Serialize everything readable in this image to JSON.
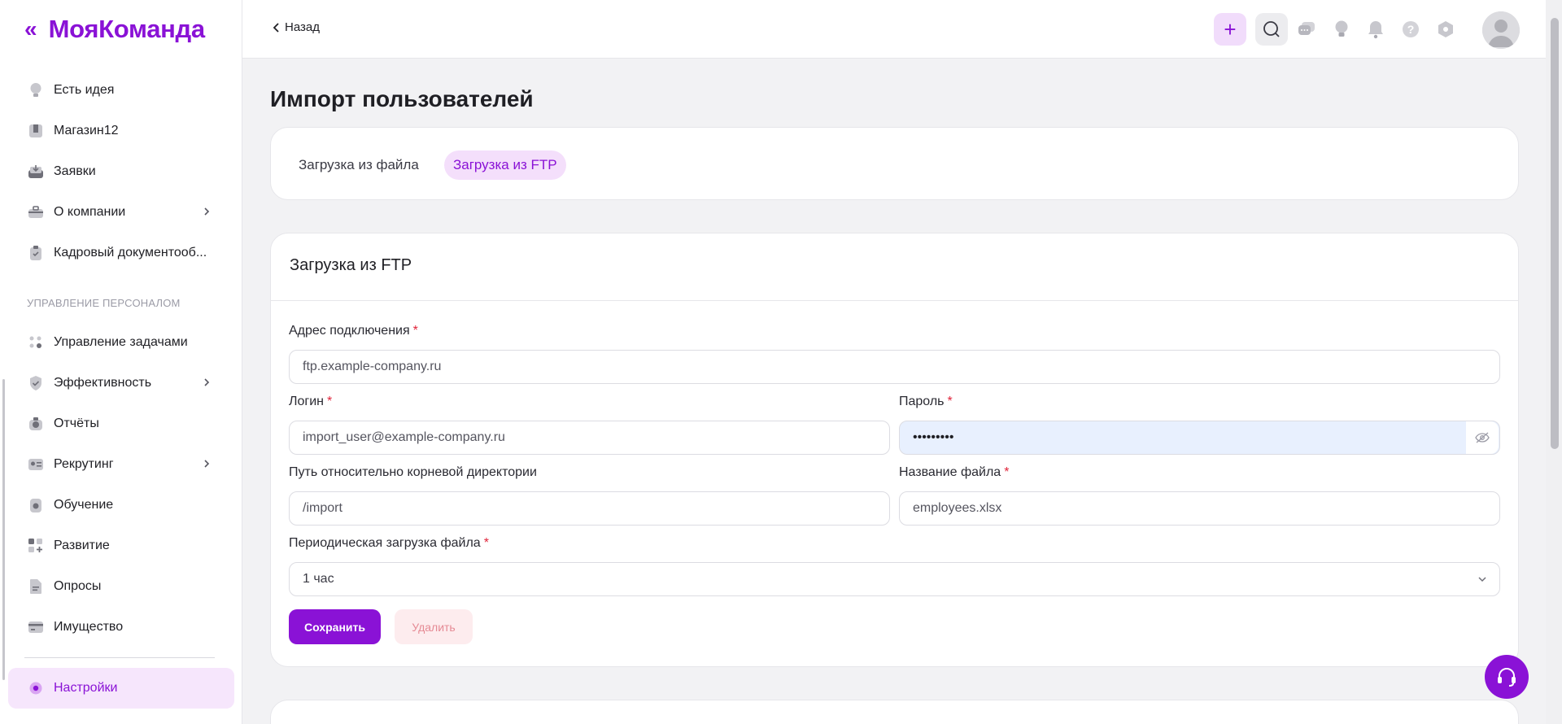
{
  "brand": {
    "name": "МояКоманда",
    "collapse_icon": "double-chevron-left-icon"
  },
  "colors": {
    "accent": "#8a12d6",
    "accent_light": "#f4dffb",
    "danger": "#e0243a"
  },
  "sidebar": {
    "items": [
      {
        "label": "Есть идея",
        "icon": "lightbulb-icon"
      },
      {
        "label": "Магазин12",
        "icon": "shop-icon"
      },
      {
        "label": "Заявки",
        "icon": "inbox-icon"
      },
      {
        "label": "О компании",
        "icon": "briefcase-icon",
        "has_submenu": true
      },
      {
        "label": "Кадровый документооб...",
        "icon": "clipboard-check-icon"
      }
    ],
    "section_title": "УПРАВЛЕНИЕ ПЕРСОНАЛОМ",
    "section_items": [
      {
        "label": "Управление задачами",
        "icon": "tasks-icon"
      },
      {
        "label": "Эффективность",
        "icon": "shield-check-icon",
        "has_submenu": true
      },
      {
        "label": "Отчёты",
        "icon": "report-icon"
      },
      {
        "label": "Рекрутинг",
        "icon": "id-card-icon",
        "has_submenu": true
      },
      {
        "label": "Обучение",
        "icon": "lock-book-icon"
      },
      {
        "label": "Развитие",
        "icon": "grid-plus-icon"
      },
      {
        "label": "Опросы",
        "icon": "survey-doc-icon"
      },
      {
        "label": "Имущество",
        "icon": "property-card-icon"
      }
    ],
    "settings": {
      "label": "Настройки",
      "icon": "gear-icon",
      "active": true
    }
  },
  "header": {
    "back_label": "Назад",
    "icons": [
      "plus-icon",
      "search-icon",
      "chat-icon",
      "lightbulb-icon",
      "bell-icon",
      "help-icon",
      "hexagon-icon"
    ]
  },
  "page": {
    "title": "Импорт пользователей",
    "tabs": [
      {
        "label": "Загрузка из файла",
        "active": false
      },
      {
        "label": "Загрузка из FTP",
        "active": true
      }
    ]
  },
  "form": {
    "title": "Загрузка из FTP",
    "address": {
      "label": "Адрес подключения",
      "value": "ftp.example-company.ru"
    },
    "login": {
      "label": "Логин",
      "value": "import_user@example-company.ru"
    },
    "password": {
      "label": "Пароль",
      "value": "•••••••••"
    },
    "path": {
      "label": "Путь относительно корневой директории",
      "value": "/import"
    },
    "filename": {
      "label": "Название файла",
      "value": "employees.xlsx"
    },
    "period": {
      "label": "Периодическая загрузка файла",
      "value": "1 час"
    },
    "required_mark": "*",
    "save_label": "Сохранить",
    "delete_label": "Удалить"
  }
}
